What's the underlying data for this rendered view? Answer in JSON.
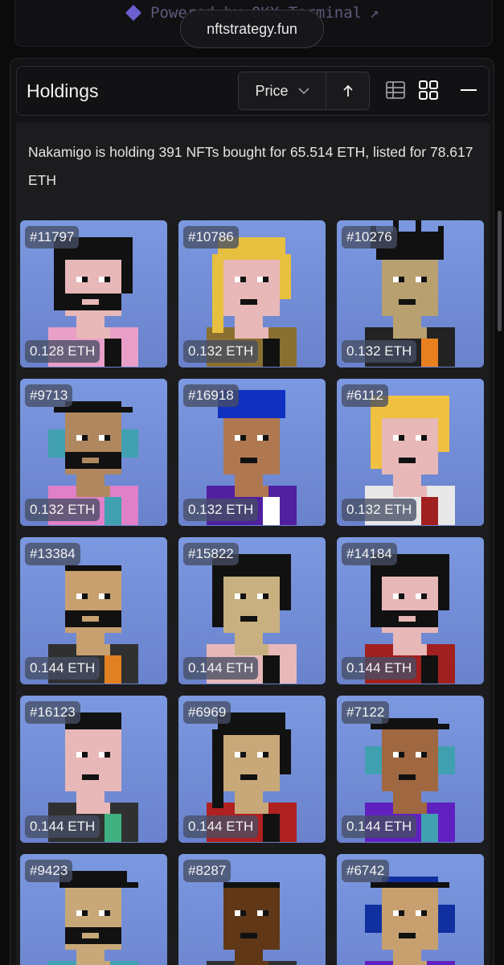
{
  "topbar": {
    "powered_text": "Powered by OKX Terminal",
    "url": "nftstrategy.fun"
  },
  "header": {
    "title": "Holdings",
    "sort_label": "Price",
    "sort_direction_icon": "arrow-up-icon",
    "view_icons": [
      "table-view-icon",
      "grid-view-icon"
    ],
    "collapse_icon": "minus-icon"
  },
  "summary": "Nakamigo is holding 391 NFTs bought for 65.514 ETH, listed for 78.617 ETH",
  "items": [
    {
      "id": "#11797",
      "price": "0.128 ETH",
      "skin": "#e8b8b8",
      "hair": "#111111",
      "shirt": "#e8a0c8",
      "acc": "#111111",
      "beard": true,
      "hairStyle": "big"
    },
    {
      "id": "#10786",
      "price": "0.132 ETH",
      "skin": "#e8b8b8",
      "hair": "#e8c040",
      "shirt": "#8a7030",
      "acc": "#111111",
      "beard": false,
      "hairStyle": "long"
    },
    {
      "id": "#10276",
      "price": "0.132 ETH",
      "skin": "#b8a070",
      "hair": "#111111",
      "shirt": "#222222",
      "acc": "#e88020",
      "beard": false,
      "hairStyle": "dreads"
    },
    {
      "id": "#9713",
      "price": "0.132 ETH",
      "skin": "#b08860",
      "hair": "#111111",
      "shirt": "#e080c8",
      "acc": "#40a0b0",
      "beard": true,
      "hairStyle": "headphones"
    },
    {
      "id": "#16918",
      "price": "0.132 ETH",
      "skin": "#b07850",
      "hair": "#1030c0",
      "shirt": "#5020a0",
      "acc": "#ffffff",
      "beard": false,
      "hairStyle": "beanie"
    },
    {
      "id": "#6112",
      "price": "0.132 ETH",
      "skin": "#e8b8b8",
      "hair": "#f0c040",
      "shirt": "#e8e8e8",
      "acc": "#a02020",
      "beard": false,
      "hairStyle": "big"
    },
    {
      "id": "#13384",
      "price": "0.144 ETH",
      "skin": "#c8a070",
      "hair": "#111111",
      "shirt": "#303030",
      "acc": "#e08020",
      "beard": true,
      "hairStyle": "bald"
    },
    {
      "id": "#15822",
      "price": "0.144 ETH",
      "skin": "#c8b080",
      "hair": "#111111",
      "shirt": "#e8b8b8",
      "acc": "#111111",
      "beard": false,
      "hairStyle": "big"
    },
    {
      "id": "#14184",
      "price": "0.144 ETH",
      "skin": "#e8b8b8",
      "hair": "#111111",
      "shirt": "#a02020",
      "acc": "#111111",
      "beard": true,
      "hairStyle": "afro"
    },
    {
      "id": "#16123",
      "price": "0.144 ETH",
      "skin": "#e8b8b8",
      "hair": "#111111",
      "shirt": "#303030",
      "acc": "#40b080",
      "beard": false,
      "hairStyle": "short"
    },
    {
      "id": "#6969",
      "price": "0.144 ETH",
      "skin": "#c8a878",
      "hair": "#111111",
      "shirt": "#b02020",
      "acc": "#111111",
      "beard": false,
      "hairStyle": "long"
    },
    {
      "id": "#7122",
      "price": "0.144 ETH",
      "skin": "#a06840",
      "hair": "#111111",
      "shirt": "#6020c0",
      "acc": "#40a0b0",
      "beard": false,
      "hairStyle": "headphones"
    },
    {
      "id": "#9423",
      "price": "",
      "skin": "#c8a878",
      "hair": "#111111",
      "shirt": "#40a0b0",
      "acc": "#111111",
      "beard": true,
      "hairStyle": "cap"
    },
    {
      "id": "#8287",
      "price": "",
      "skin": "#603818",
      "hair": "#111111",
      "shirt": "#303030",
      "acc": "#111111",
      "beard": false,
      "hairStyle": "bald"
    },
    {
      "id": "#6742",
      "price": "",
      "skin": "#c8a070",
      "hair": "#1030a0",
      "shirt": "#6020c0",
      "acc": "#1030a0",
      "beard": false,
      "hairStyle": "headphones"
    }
  ]
}
